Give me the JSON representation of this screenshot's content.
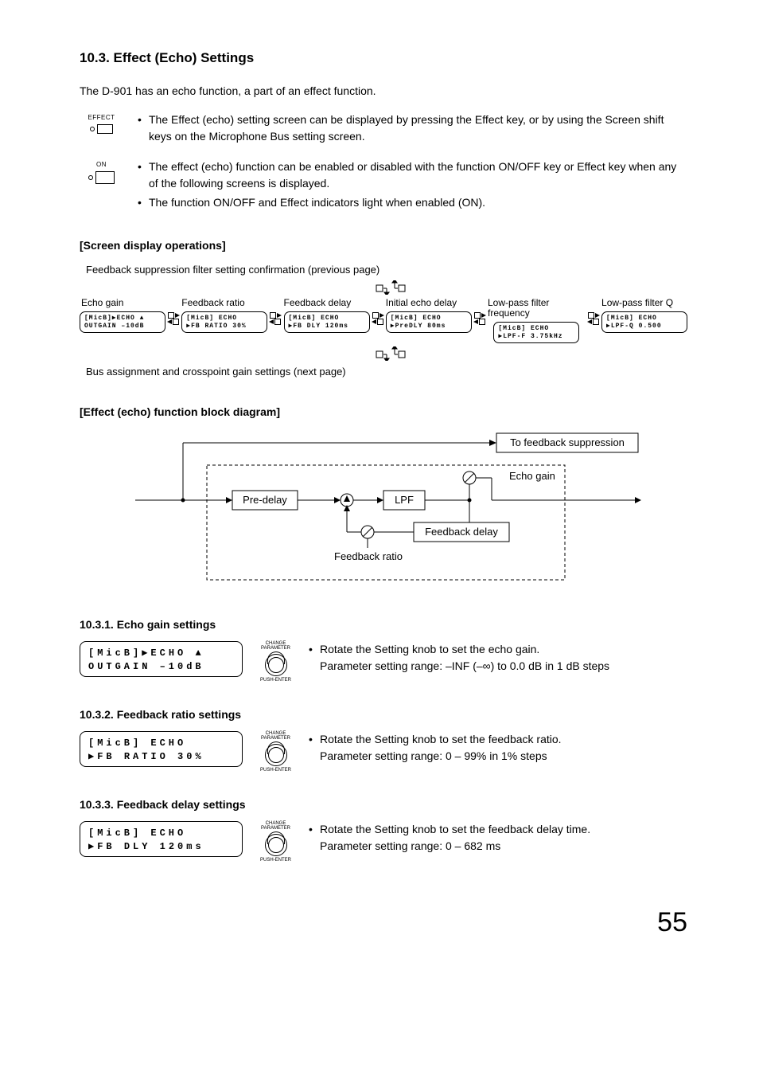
{
  "section_title": "10.3. Effect (Echo) Settings",
  "intro": "The D-901 has an echo function, a part of an effect function.",
  "effect_key": {
    "label": "EFFECT"
  },
  "on_key": {
    "label": "ON"
  },
  "bullets1": [
    "The Effect (echo) setting screen can be displayed by pressing the Effect key, or by using the Screen shift keys on the Microphone Bus setting screen."
  ],
  "bullets2": [
    "The effect (echo) function can be enabled or disabled with the function ON/OFF key or Effect key when any of the following screens is displayed.",
    "The function ON/OFF and Effect indicators light when enabled (ON)."
  ],
  "screen_ops_title": "[Screen display operations]",
  "prev_page_note": "Feedback suppression filter setting confirmation (previous page)",
  "next_page_note": "Bus assignment and crosspoint gain settings (next page)",
  "flow": [
    {
      "label": "Echo gain",
      "line1": "[MicB]▶ECHO   ▲",
      "line2": "OUTGAIN  –10dB"
    },
    {
      "label": "Feedback ratio",
      "line1": "[MicB] ECHO",
      "line2": "▶FB RATIO  30%"
    },
    {
      "label": "Feedback delay",
      "line1": "[MicB] ECHO",
      "line2": "▶FB DLY  120ms"
    },
    {
      "label": "Initial echo delay",
      "line1": "[MicB] ECHO",
      "line2": "▶PreDLY   80ms"
    },
    {
      "label": "Low-pass filter frequency",
      "line1": "[MicB] ECHO",
      "line2": "▶LPF-F 3.75kHz"
    },
    {
      "label": "Low-pass filter Q",
      "line1": "[MicB] ECHO",
      "line2": "▶LPF-Q  0.500"
    }
  ],
  "block_title": "[Effect (echo) function block diagram]",
  "bd": {
    "to_fb": "To feedback suppression",
    "echo_gain": "Echo gain",
    "pre_delay": "Pre-delay",
    "lpf": "LPF",
    "fb_delay": "Feedback delay",
    "fb_ratio": "Feedback ratio"
  },
  "knob": {
    "top1": "CHANGE",
    "top2": "PARAMETER",
    "bottom": "PUSH-ENTER"
  },
  "s1": {
    "title": "10.3.1. Echo gain settings",
    "line1": "[MicB]▶ECHO    ▲",
    "line2": "OUTGAIN   –10dB",
    "b1": "Rotate the Setting knob to set the echo gain.",
    "b2": "Parameter setting range: –INF (–∞) to 0.0 dB in 1 dB steps"
  },
  "s2": {
    "title": "10.3.2. Feedback ratio settings",
    "line1": "[MicB] ECHO",
    "line2": "▶FB RATIO   30%",
    "b1": "Rotate the Setting knob to set the feedback ratio.",
    "b2": "Parameter setting range: 0 – 99% in 1% steps"
  },
  "s3": {
    "title": "10.3.3. Feedback delay settings",
    "line1": "[MicB] ECHO",
    "line2": "▶FB DLY   120ms",
    "b1": "Rotate the Setting knob to set the feedback delay time.",
    "b2": "Parameter setting range: 0 – 682 ms"
  },
  "page_number": "55"
}
